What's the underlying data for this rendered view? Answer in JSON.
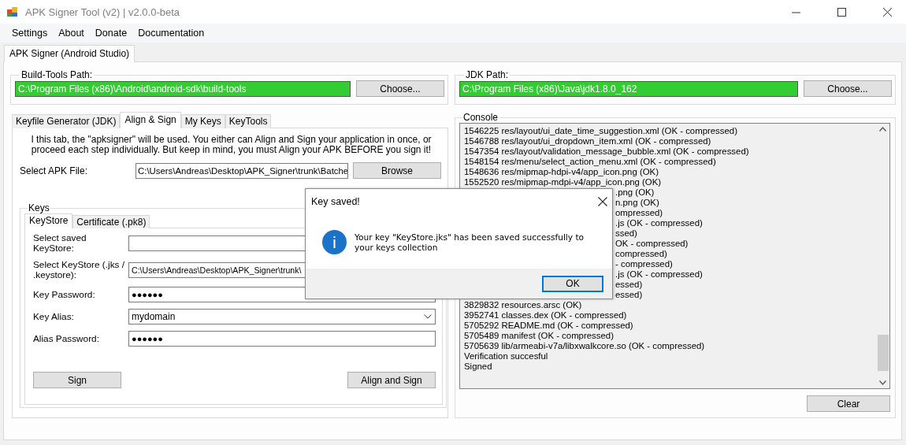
{
  "window": {
    "title": "APK Signer Tool (v2) | v2.0.0-beta"
  },
  "menu": [
    "Settings",
    "About",
    "Donate",
    "Documentation"
  ],
  "main_tabs": [
    {
      "label": "APK Signer (Android Studio)",
      "selected": true
    }
  ],
  "build_tools": {
    "label": "Build-Tools Path:",
    "value": "C:\\Program Files (x86)\\Android\\android-sdk\\build-tools",
    "valid": true,
    "button": "Choose..."
  },
  "jdk": {
    "label": "JDK Path:",
    "value": "C:\\Program Files (x86)\\Java\\jdk1.8.0_162",
    "valid": true,
    "button": "Choose..."
  },
  "tabs": [
    {
      "label": "Keyfile Generator (JDK)",
      "selected": false
    },
    {
      "label": "Align & Sign",
      "selected": true
    },
    {
      "label": "My Keys",
      "selected": false
    },
    {
      "label": "KeyTools",
      "selected": false
    }
  ],
  "align_sign": {
    "description": "I this tab, the \"apksigner\" will be used. You either can Align and Sign your application in once, or proceed each step individually. But keep in mind, you must Align your APK BEFORE you sign it!",
    "apk_label": "Select APK File:",
    "apk_value": "C:\\Users\\Andreas\\Desktop\\APK_Signer\\trunk\\Batche",
    "browse_button": "Browse",
    "keys": {
      "title": "Keys",
      "tabs": [
        {
          "label": "KeyStore",
          "selected": true
        },
        {
          "label": "Certificate (.pk8)",
          "selected": false
        }
      ],
      "fields": [
        {
          "kind": "text",
          "label": "Select saved KeyStore:"
        },
        {
          "kind": "text",
          "label": "Select KeyStore (.jks / .keystore):",
          "value": "C:\\Users\\Andreas\\Desktop\\APK_Signer\\trunk\\"
        },
        {
          "kind": "password",
          "label": "Key Password:",
          "value": "●●●●●●"
        },
        {
          "kind": "combo",
          "label": "Key Alias:",
          "value": "mydomain"
        },
        {
          "kind": "password",
          "label": "Alias Password:",
          "value": "●●●●●●"
        }
      ],
      "buttons": [
        "Sign",
        "Align and Sign"
      ]
    }
  },
  "console": {
    "title": "Console",
    "lines": [
      {
        "kind": "full",
        "text": "1546225 res/layout/ui_date_time_suggestion.xml (OK - compressed)"
      },
      {
        "kind": "full",
        "text": "1546788 res/layout/ui_dropdown_item.xml (OK - compressed)"
      },
      {
        "kind": "full",
        "text": "1547354 res/layout/validation_message_bubble.xml (OK - compressed)"
      },
      {
        "kind": "full",
        "text": "1548154 res/menu/select_action_menu.xml (OK - compressed)"
      },
      {
        "kind": "full",
        "text": "1548636 res/mipmap-hdpi-v4/app_icon.png (OK)"
      },
      {
        "kind": "full",
        "text": "1552520 res/mipmap-mdpi-v4/app_icon.png (OK)"
      },
      {
        "kind": "partial",
        "text": ".png (OK)"
      },
      {
        "kind": "partial",
        "text": "n.png (OK)"
      },
      {
        "kind": "partial",
        "text": "ompressed)"
      },
      {
        "kind": "partial",
        "text": ".js (OK - compressed)"
      },
      {
        "kind": "partial",
        "text": "ssed)"
      },
      {
        "kind": "partial",
        "text": "OK - compressed)"
      },
      {
        "kind": "partial",
        "text": "compressed)"
      },
      {
        "kind": "partial",
        "text": "- compressed)"
      },
      {
        "kind": "partial",
        "text": ".js (OK - compressed)"
      },
      {
        "kind": "partial",
        "text": "essed)"
      },
      {
        "kind": "partial",
        "text": "essed)"
      },
      {
        "kind": "full",
        "text": "3829832 resources.arsc (OK)"
      },
      {
        "kind": "full",
        "text": "3952741 classes.dex (OK - compressed)"
      },
      {
        "kind": "full",
        "text": "5705292 README.md (OK - compressed)"
      },
      {
        "kind": "full",
        "text": "5705489 manifest (OK - compressed)"
      },
      {
        "kind": "full",
        "text": "5705639 lib/armeabi-v7a/libxwalkcore.so (OK - compressed)"
      },
      {
        "kind": "full",
        "text": "Verification succesful"
      },
      {
        "kind": "full",
        "text": "Signed"
      }
    ],
    "clear_button": "Clear"
  },
  "dialog": {
    "title": "Key saved!",
    "message": "Your key \"KeyStore.jks\" has been saved successfully to your keys collection",
    "button": "OK"
  }
}
